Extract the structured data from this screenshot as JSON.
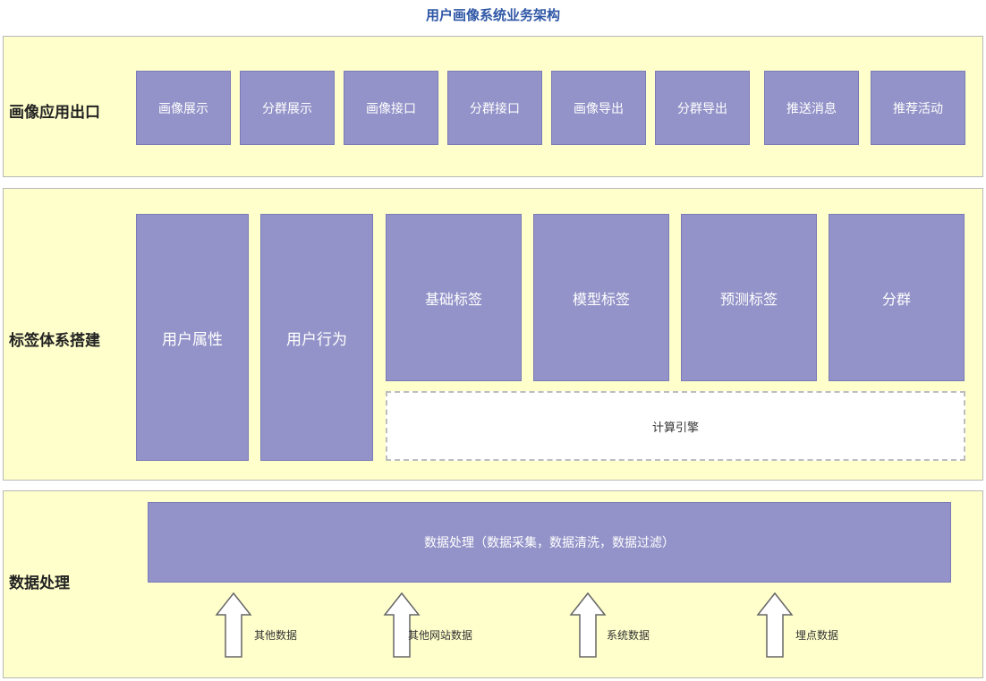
{
  "title": "用户画像系统业务架构",
  "layers": {
    "app": {
      "label": "画像应用出口",
      "items": [
        "画像展示",
        "分群展示",
        "画像接口",
        "分群接口",
        "画像导出",
        "分群导出",
        "推送消息",
        "推荐活动"
      ]
    },
    "tags": {
      "label": "标签体系搭建",
      "left_items": [
        "用户属性",
        "用户行为"
      ],
      "tag_items": [
        "基础标签",
        "模型标签",
        "预测标签",
        "分群"
      ],
      "engine": "计算引擎"
    },
    "data": {
      "label": "数据处理",
      "process": "数据处理（数据采集，数据清洗，数据过滤）",
      "sources": [
        "其他数据",
        "其他网站数据",
        "系统数据",
        "埋点数据"
      ]
    }
  }
}
